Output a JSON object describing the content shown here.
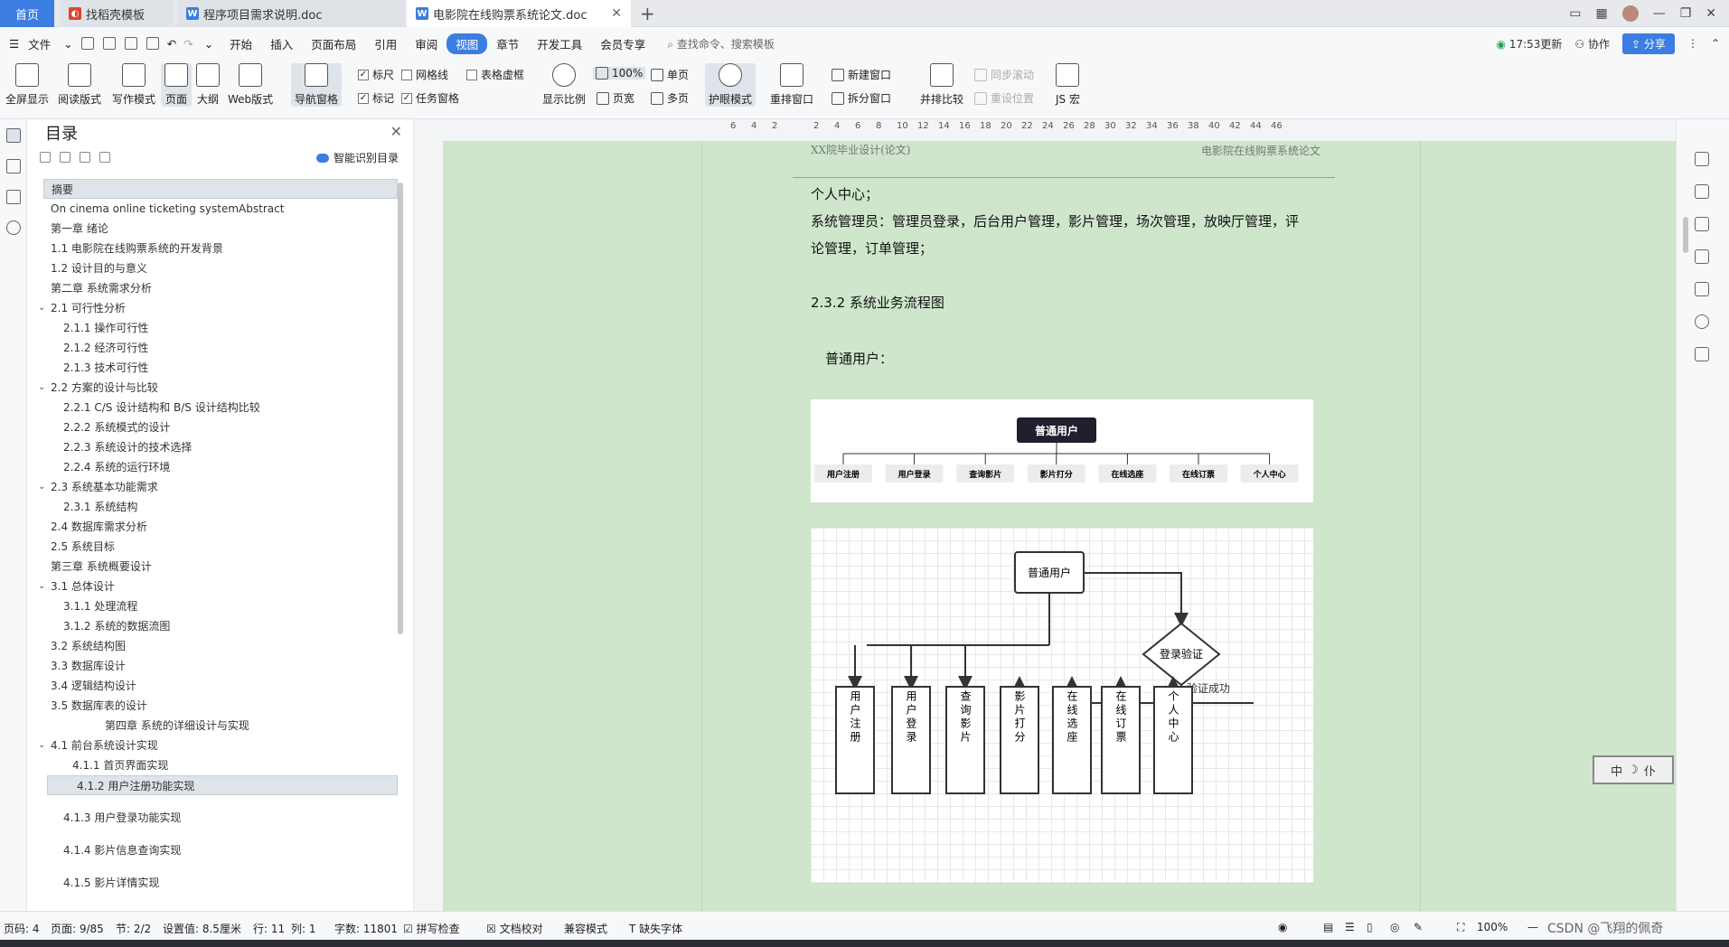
{
  "tabs": {
    "home": "首页",
    "t1": "找稻壳模板",
    "t2": "程序项目需求说明.doc",
    "t3": "电影院在线购票系统论文.doc"
  },
  "menu": {
    "file": "文件",
    "items": [
      "开始",
      "插入",
      "页面布局",
      "引用",
      "审阅",
      "视图",
      "章节",
      "开发工具",
      "会员专享"
    ],
    "active": "视图",
    "search": "查找命令、搜索模板",
    "update": "17:53更新",
    "collab": "协作",
    "share": "分享"
  },
  "ribbon": {
    "fullscreen": "全屏显示",
    "reading": "阅读版式",
    "writing": "写作模式",
    "page": "页面",
    "outline": "大纲",
    "web": "Web版式",
    "nav": "导航窗格",
    "ruler": "标尺",
    "gridlines": "网格线",
    "tablegrid": "表格虚框",
    "marks": "标记",
    "taskpane": "任务窗格",
    "zoom_ratio": "显示比例",
    "zoom_value": "100%",
    "pagewidth": "页宽",
    "single": "单页",
    "multi": "多页",
    "eyecare": "护眼模式",
    "rearrange": "重排窗口",
    "newwin": "新建窗口",
    "splitwin": "拆分窗口",
    "sidebyside": "并排比较",
    "syncscroll": "同步滚动",
    "resetpos": "重设位置",
    "jsmacro": "JS 宏"
  },
  "toc": {
    "title": "目录",
    "smart": "智能识别目录",
    "items": [
      {
        "text": "摘要",
        "level": 0,
        "sel": true
      },
      {
        "text": "On cinema online ticketing systemAbstract",
        "level": 0
      },
      {
        "text": "第一章  绪论",
        "level": 0
      },
      {
        "text": "1.1  电影院在线购票系统的开发背景",
        "level": 0
      },
      {
        "text": "1.2 设计目的与意义",
        "level": 0
      },
      {
        "text": "第二章  系统需求分析",
        "level": 0
      },
      {
        "text": "2.1  可行性分析",
        "level": 0,
        "caret": true
      },
      {
        "text": "2.1.1  操作可行性",
        "level": 1
      },
      {
        "text": "2.1.2  经济可行性",
        "level": 1
      },
      {
        "text": "2.1.3  技术可行性",
        "level": 1
      },
      {
        "text": "2.2 方案的设计与比较",
        "level": 0,
        "caret": true
      },
      {
        "text": "2.2.1 C/S 设计结构和 B/S 设计结构比较",
        "level": 1
      },
      {
        "text": "2.2.2  系统模式的设计",
        "level": 1
      },
      {
        "text": "2.2.3 系统设计的技术选择",
        "level": 1
      },
      {
        "text": "2.2.4 系统的运行环境",
        "level": 1
      },
      {
        "text": "2.3  系统基本功能需求",
        "level": 0,
        "caret": true
      },
      {
        "text": "2.3.1  系统结构",
        "level": 1
      },
      {
        "text": "2.4  数据库需求分析",
        "level": 0
      },
      {
        "text": "2.5  系统目标",
        "level": 0
      },
      {
        "text": "第三章  系统概要设计",
        "level": 0
      },
      {
        "text": "3.1 总体设计",
        "level": 0,
        "caret": true
      },
      {
        "text": "3.1.1  处理流程",
        "level": 1
      },
      {
        "text": "3.1.2 系统的数据流图",
        "level": 1
      },
      {
        "text": "3.2  系统结构图",
        "level": 0
      },
      {
        "text": "3.3 数据库设计",
        "level": 0
      },
      {
        "text": "3.4 逻辑结构设计",
        "level": 0
      },
      {
        "text": "3.5 数据库表的设计",
        "level": 0
      },
      {
        "text": "第四章  系统的详细设计与实现",
        "level": 3
      },
      {
        "text": "4.1  前台系统设计实现",
        "level": 0,
        "caret": true
      },
      {
        "text": "4.1.1  首页界面实现",
        "level": 2
      },
      {
        "text": "4.1.2  用户注册功能实现",
        "level": 2,
        "sel2": true
      },
      {
        "text": "",
        "level": 0
      },
      {
        "text": "4.1.3  用户登录功能实现",
        "level": 1
      },
      {
        "text": "",
        "level": 0
      },
      {
        "text": "4.1.4  影片信息查询实现",
        "level": 1
      },
      {
        "text": "",
        "level": 0
      },
      {
        "text": "4.1.5  影片详情实现",
        "level": 1
      }
    ]
  },
  "ruler_marks": [
    "6",
    "4",
    "2",
    "",
    "2",
    "4",
    "6",
    "8",
    "10",
    "12",
    "14",
    "16",
    "18",
    "20",
    "22",
    "24",
    "26",
    "28",
    "30",
    "32",
    "34",
    "36",
    "38",
    "40",
    "42",
    "44",
    "46"
  ],
  "doc": {
    "header_left": "XX院毕业设计(论文)",
    "header_right": "电影院在线购票系统论文",
    "line1": "个人中心；",
    "line2": "系统管理员：管理员登录，后台用户管理，影片管理，场次管理，放映厅管理，评",
    "line3": "论管理，订单管理；",
    "section": "2.3.2  系统业务流程图",
    "user_label": "普通用户：",
    "org": {
      "root": "普通用户",
      "children": [
        "用户注册",
        "用户登录",
        "查询影片",
        "影片打分",
        "在线选座",
        "在线订票",
        "个人中心"
      ]
    },
    "flow": {
      "start": "普通用户",
      "decision": "登录验证",
      "success": "验证成功",
      "boxes": [
        "用户注册",
        "用户登录",
        "查询影片",
        "影片打分",
        "在线选座",
        "在线订票",
        "个人中心"
      ]
    }
  },
  "ime": {
    "a": "中",
    "b": "☽",
    "c": "仆"
  },
  "status": {
    "pagecode": "页码: 4",
    "pages": "页面: 9/85",
    "section": "节: 2/2",
    "setting": "设置值: 8.5厘米",
    "row": "行: 11",
    "col": "列: 1",
    "words": "字数: 11801",
    "spell": "拼写检查",
    "doccheck": "文档校对",
    "compat": "兼容模式",
    "missingfont": "缺失字体",
    "zoom": "100%",
    "watermark": "CSDN @飞翔的佩奇"
  }
}
